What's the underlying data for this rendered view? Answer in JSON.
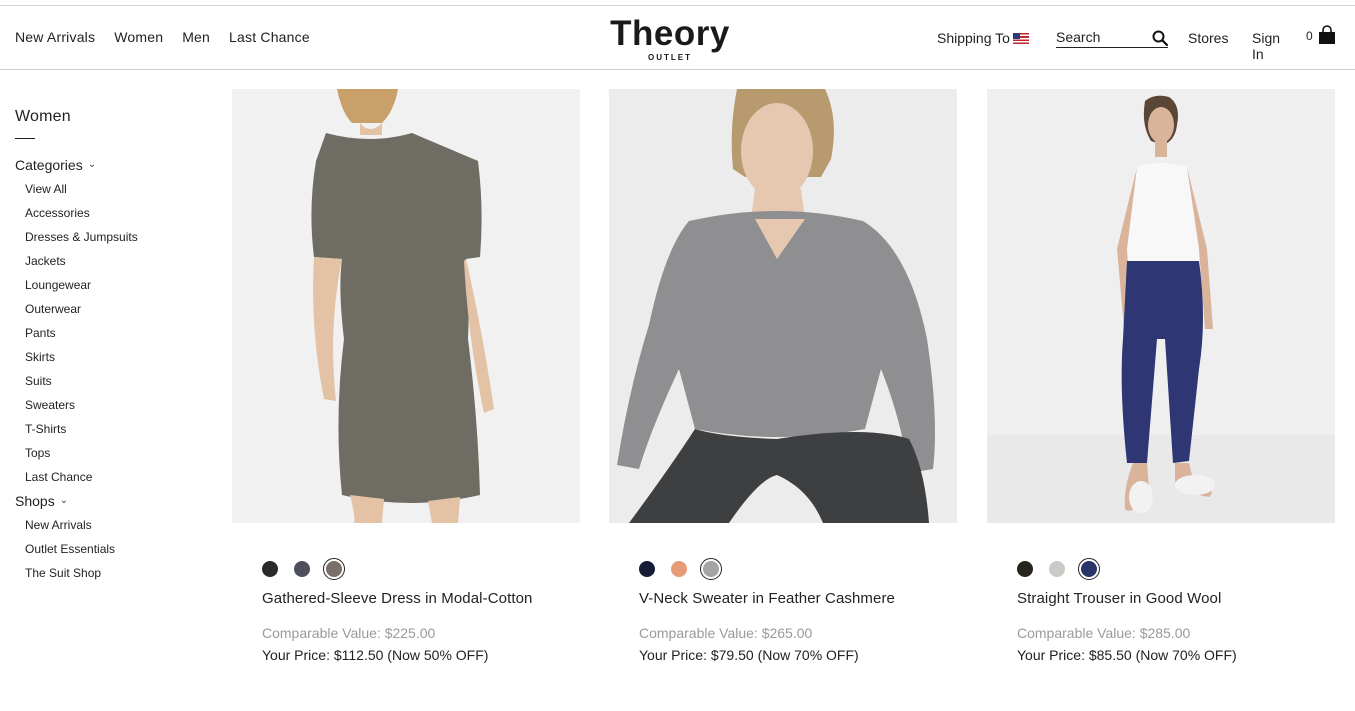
{
  "header": {
    "nav": [
      "New Arrivals",
      "Women",
      "Men",
      "Last Chance"
    ],
    "logo": "Theory",
    "logo_sub": "OUTLET",
    "shipping_label": "Shipping To",
    "search_placeholder": "Search",
    "stores": "Stores",
    "sign_in": "Sign In",
    "cart_count": "0"
  },
  "sidebar": {
    "title": "Women",
    "categories_label": "Categories",
    "categories": [
      "View All",
      "Accessories",
      "Dresses & Jumpsuits",
      "Jackets",
      "Loungewear",
      "Outerwear",
      "Pants",
      "Skirts",
      "Suits",
      "Sweaters",
      "T-Shirts",
      "Tops",
      "Last Chance"
    ],
    "shops_label": "Shops",
    "shops": [
      "New Arrivals",
      "Outlet Essentials",
      "The Suit Shop"
    ]
  },
  "products": [
    {
      "name": "Gathered-Sleeve Dress in Modal-Cotton",
      "comparable": "Comparable Value: $225.00",
      "price": "Your Price: $112.50 (Now 50% OFF)",
      "swatches": [
        "#2a2a2a",
        "#4e4f5c",
        "#7a7069"
      ],
      "selected": 2
    },
    {
      "name": "V-Neck Sweater in Feather Cashmere",
      "comparable": "Comparable Value: $265.00",
      "price": "Your Price: $79.50 (Now 70% OFF)",
      "swatches": [
        "#151c33",
        "#e79a76",
        "#a4a4a4"
      ],
      "selected": 2
    },
    {
      "name": "Straight Trouser in Good Wool",
      "comparable": "Comparable Value: $285.00",
      "price": "Your Price: $85.50 (Now 70% OFF)",
      "swatches": [
        "#28251f",
        "#c9c9c6",
        "#2a3466"
      ],
      "selected": 2
    }
  ]
}
